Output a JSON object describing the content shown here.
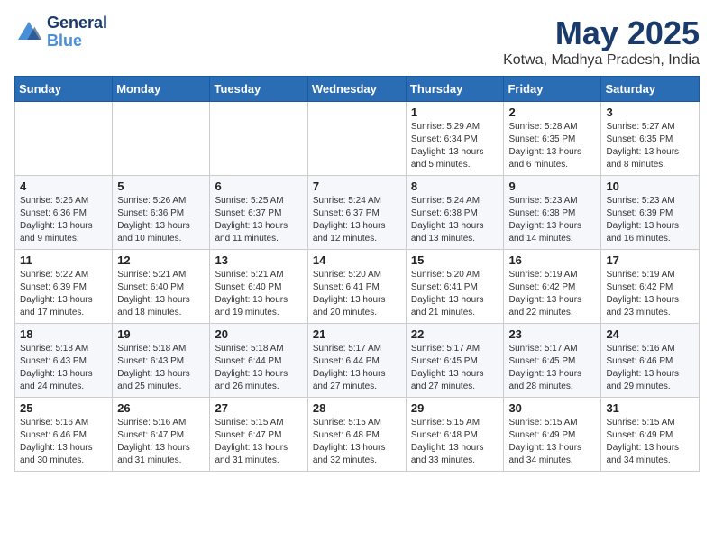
{
  "logo": {
    "line1": "General",
    "line2": "Blue"
  },
  "title": "May 2025",
  "location": "Kotwa, Madhya Pradesh, India",
  "days_of_week": [
    "Sunday",
    "Monday",
    "Tuesday",
    "Wednesday",
    "Thursday",
    "Friday",
    "Saturday"
  ],
  "weeks": [
    [
      {
        "day": "",
        "info": ""
      },
      {
        "day": "",
        "info": ""
      },
      {
        "day": "",
        "info": ""
      },
      {
        "day": "",
        "info": ""
      },
      {
        "day": "1",
        "info": "Sunrise: 5:29 AM\nSunset: 6:34 PM\nDaylight: 13 hours\nand 5 minutes."
      },
      {
        "day": "2",
        "info": "Sunrise: 5:28 AM\nSunset: 6:35 PM\nDaylight: 13 hours\nand 6 minutes."
      },
      {
        "day": "3",
        "info": "Sunrise: 5:27 AM\nSunset: 6:35 PM\nDaylight: 13 hours\nand 8 minutes."
      }
    ],
    [
      {
        "day": "4",
        "info": "Sunrise: 5:26 AM\nSunset: 6:36 PM\nDaylight: 13 hours\nand 9 minutes."
      },
      {
        "day": "5",
        "info": "Sunrise: 5:26 AM\nSunset: 6:36 PM\nDaylight: 13 hours\nand 10 minutes."
      },
      {
        "day": "6",
        "info": "Sunrise: 5:25 AM\nSunset: 6:37 PM\nDaylight: 13 hours\nand 11 minutes."
      },
      {
        "day": "7",
        "info": "Sunrise: 5:24 AM\nSunset: 6:37 PM\nDaylight: 13 hours\nand 12 minutes."
      },
      {
        "day": "8",
        "info": "Sunrise: 5:24 AM\nSunset: 6:38 PM\nDaylight: 13 hours\nand 13 minutes."
      },
      {
        "day": "9",
        "info": "Sunrise: 5:23 AM\nSunset: 6:38 PM\nDaylight: 13 hours\nand 14 minutes."
      },
      {
        "day": "10",
        "info": "Sunrise: 5:23 AM\nSunset: 6:39 PM\nDaylight: 13 hours\nand 16 minutes."
      }
    ],
    [
      {
        "day": "11",
        "info": "Sunrise: 5:22 AM\nSunset: 6:39 PM\nDaylight: 13 hours\nand 17 minutes."
      },
      {
        "day": "12",
        "info": "Sunrise: 5:21 AM\nSunset: 6:40 PM\nDaylight: 13 hours\nand 18 minutes."
      },
      {
        "day": "13",
        "info": "Sunrise: 5:21 AM\nSunset: 6:40 PM\nDaylight: 13 hours\nand 19 minutes."
      },
      {
        "day": "14",
        "info": "Sunrise: 5:20 AM\nSunset: 6:41 PM\nDaylight: 13 hours\nand 20 minutes."
      },
      {
        "day": "15",
        "info": "Sunrise: 5:20 AM\nSunset: 6:41 PM\nDaylight: 13 hours\nand 21 minutes."
      },
      {
        "day": "16",
        "info": "Sunrise: 5:19 AM\nSunset: 6:42 PM\nDaylight: 13 hours\nand 22 minutes."
      },
      {
        "day": "17",
        "info": "Sunrise: 5:19 AM\nSunset: 6:42 PM\nDaylight: 13 hours\nand 23 minutes."
      }
    ],
    [
      {
        "day": "18",
        "info": "Sunrise: 5:18 AM\nSunset: 6:43 PM\nDaylight: 13 hours\nand 24 minutes."
      },
      {
        "day": "19",
        "info": "Sunrise: 5:18 AM\nSunset: 6:43 PM\nDaylight: 13 hours\nand 25 minutes."
      },
      {
        "day": "20",
        "info": "Sunrise: 5:18 AM\nSunset: 6:44 PM\nDaylight: 13 hours\nand 26 minutes."
      },
      {
        "day": "21",
        "info": "Sunrise: 5:17 AM\nSunset: 6:44 PM\nDaylight: 13 hours\nand 27 minutes."
      },
      {
        "day": "22",
        "info": "Sunrise: 5:17 AM\nSunset: 6:45 PM\nDaylight: 13 hours\nand 27 minutes."
      },
      {
        "day": "23",
        "info": "Sunrise: 5:17 AM\nSunset: 6:45 PM\nDaylight: 13 hours\nand 28 minutes."
      },
      {
        "day": "24",
        "info": "Sunrise: 5:16 AM\nSunset: 6:46 PM\nDaylight: 13 hours\nand 29 minutes."
      }
    ],
    [
      {
        "day": "25",
        "info": "Sunrise: 5:16 AM\nSunset: 6:46 PM\nDaylight: 13 hours\nand 30 minutes."
      },
      {
        "day": "26",
        "info": "Sunrise: 5:16 AM\nSunset: 6:47 PM\nDaylight: 13 hours\nand 31 minutes."
      },
      {
        "day": "27",
        "info": "Sunrise: 5:15 AM\nSunset: 6:47 PM\nDaylight: 13 hours\nand 31 minutes."
      },
      {
        "day": "28",
        "info": "Sunrise: 5:15 AM\nSunset: 6:48 PM\nDaylight: 13 hours\nand 32 minutes."
      },
      {
        "day": "29",
        "info": "Sunrise: 5:15 AM\nSunset: 6:48 PM\nDaylight: 13 hours\nand 33 minutes."
      },
      {
        "day": "30",
        "info": "Sunrise: 5:15 AM\nSunset: 6:49 PM\nDaylight: 13 hours\nand 34 minutes."
      },
      {
        "day": "31",
        "info": "Sunrise: 5:15 AM\nSunset: 6:49 PM\nDaylight: 13 hours\nand 34 minutes."
      }
    ]
  ]
}
